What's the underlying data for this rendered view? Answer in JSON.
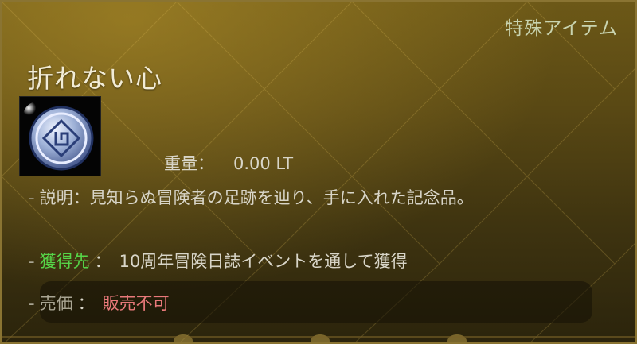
{
  "tooltip": {
    "category": "特殊アイテム",
    "title": "折れない心",
    "icon": "coin-emblem-icon",
    "weight": {
      "label": "重量：",
      "value": "0.00 LT"
    },
    "description": {
      "prefix": "-",
      "label": "説明：",
      "text": "見知らぬ冒険者の足跡を辿り、手に入れた記念品。"
    },
    "source": {
      "prefix": "-",
      "label": "獲得先",
      "separator": "：",
      "text": "10周年冒険日誌イベントを通して獲得"
    },
    "price": {
      "prefix": "-",
      "label": "売価",
      "separator": "：",
      "text": "販売不可"
    },
    "colors": {
      "accent_green": "#56d548",
      "unsellable_red": "#e8797a",
      "background_gold": "#6c5817"
    }
  }
}
